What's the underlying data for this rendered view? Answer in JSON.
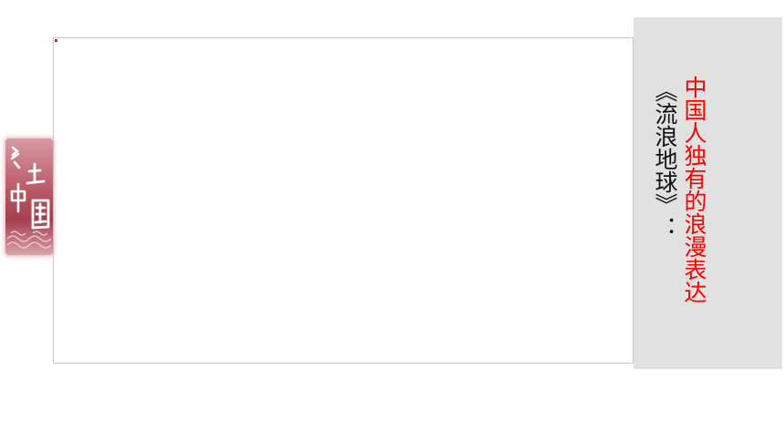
{
  "slide": {
    "heading_red": "中国人独有的浪漫表达",
    "heading_black": "《流浪地球》："
  },
  "seal": {
    "text": "乡土中国",
    "colors": {
      "background": "#b95866",
      "text": "#ffffff"
    }
  },
  "colors": {
    "panel": "#e1e1e1",
    "accent_red": "#ff0000",
    "frame_border": "#c9c9c9"
  }
}
